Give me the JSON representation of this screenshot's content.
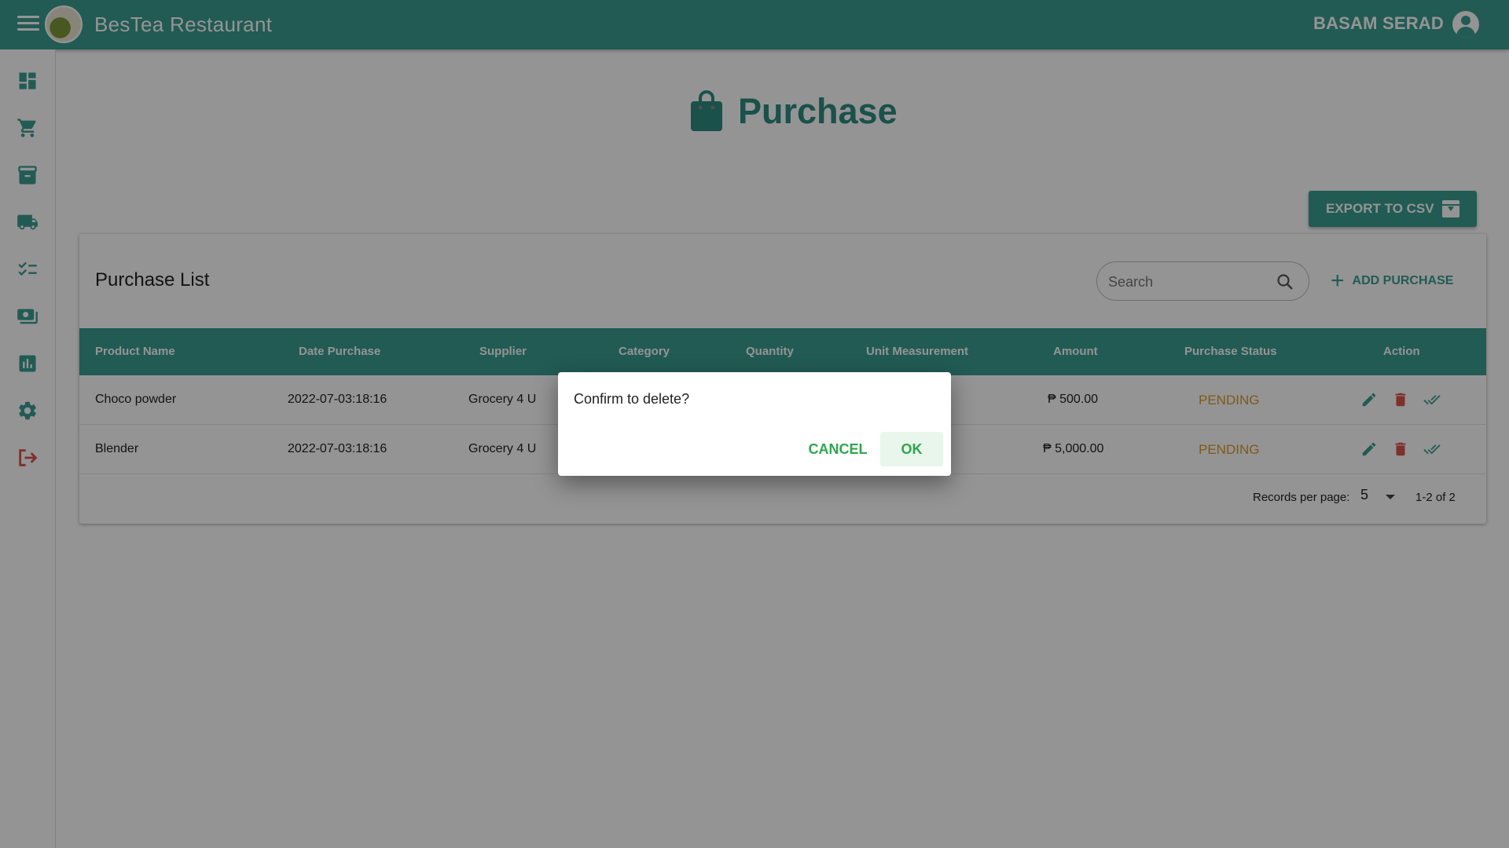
{
  "app": {
    "title": "BesTea Restaurant",
    "logo_text": "BesTea",
    "user_name": "BASAM SERAD"
  },
  "colors": {
    "primary": "#3a9e92",
    "status_pending": "#e09a2a",
    "delete": "#d9534f",
    "dialog_action": "#2fa64e"
  },
  "sidebar": {
    "items": [
      {
        "icon": "dashboard-icon"
      },
      {
        "icon": "cart-icon"
      },
      {
        "icon": "archive-box-icon"
      },
      {
        "icon": "truck-icon"
      },
      {
        "icon": "checklist-icon"
      },
      {
        "icon": "payments-icon"
      },
      {
        "icon": "report-chart-icon"
      },
      {
        "icon": "gear-icon"
      },
      {
        "icon": "logout-icon"
      }
    ]
  },
  "page": {
    "title": "Purchase",
    "export_label": "EXPORT TO CSV"
  },
  "card": {
    "title": "Purchase List",
    "search_placeholder": "Search",
    "add_label": "ADD PURCHASE"
  },
  "table": {
    "headers": [
      "Product Name",
      "Date Purchase",
      "Supplier",
      "Category",
      "Quantity",
      "Unit Measurement",
      "Amount",
      "Purchase Status",
      "Action"
    ],
    "rows": [
      {
        "product": "Choco powder",
        "date": "2022-07-03:18:16",
        "supplier": "Grocery 4 U",
        "amount": "₱ 500.00",
        "status": "PENDING"
      },
      {
        "product": "Blender",
        "date": "2022-07-03:18:16",
        "supplier": "Grocery 4 U",
        "amount": "₱ 5,000.00",
        "status": "PENDING"
      }
    ]
  },
  "pagination": {
    "label": "Records per page:",
    "per_page": "5",
    "range": "1-2 of 2"
  },
  "dialog": {
    "message": "Confirm to delete?",
    "cancel": "CANCEL",
    "ok": "OK"
  }
}
